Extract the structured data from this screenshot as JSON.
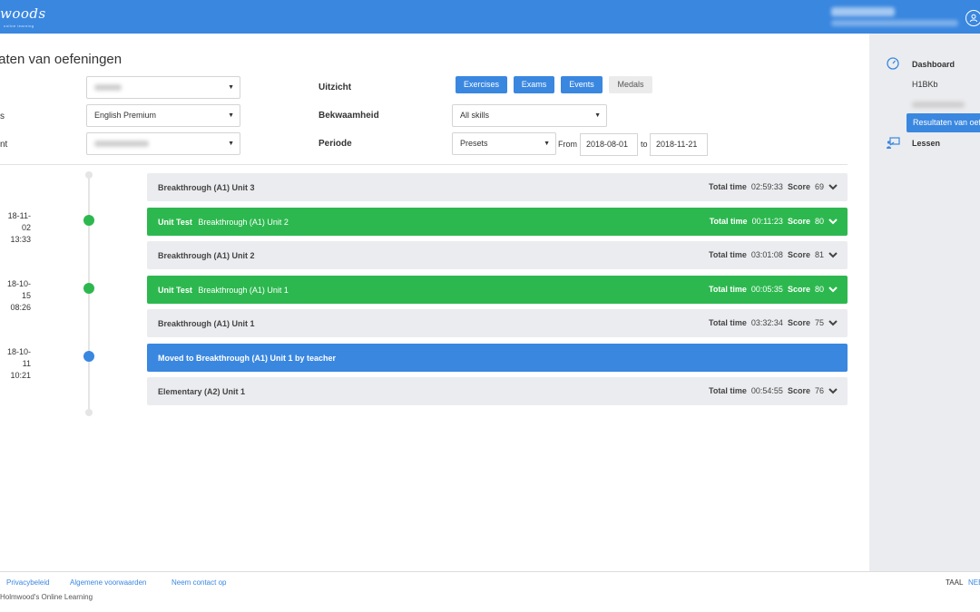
{
  "header": {
    "logo": "woods",
    "logo_sub": "online learning"
  },
  "page": {
    "title": "taten van oefeningen"
  },
  "filters": {
    "label_row2": "s",
    "label_row3": "nt",
    "course_value": "English Premium",
    "uitzicht_label": "Uitzicht",
    "bekwaamheid_label": "Bekwaamheid",
    "periode_label": "Periode",
    "view_buttons": [
      "Exercises",
      "Exams",
      "Events",
      "Medals"
    ],
    "skill_value": "All skills",
    "period_value": "Presets",
    "from_label": "From",
    "from_date": "2018-08-01",
    "to_label": "to",
    "to_date": "2018-11-21"
  },
  "timeline": {
    "dates": [
      {
        "date": "18-11-02",
        "time": "13:33"
      },
      {
        "date": "18-10-15",
        "time": "08:26"
      },
      {
        "date": "18-10-11",
        "time": "10:21"
      }
    ],
    "rows": [
      {
        "prefix": "",
        "title": "Breakthrough (A1) Unit 3",
        "time_label": "Total time",
        "time": "02:59:33",
        "score_label": "Score",
        "score": "69"
      },
      {
        "prefix": "Unit Test",
        "title": "Breakthrough (A1) Unit 2",
        "time_label": "Total time",
        "time": "00:11:23",
        "score_label": "Score",
        "score": "80"
      },
      {
        "prefix": "",
        "title": "Breakthrough (A1) Unit 2",
        "time_label": "Total time",
        "time": "03:01:08",
        "score_label": "Score",
        "score": "81"
      },
      {
        "prefix": "Unit Test",
        "title": "Breakthrough (A1) Unit 1",
        "time_label": "Total time",
        "time": "00:05:35",
        "score_label": "Score",
        "score": "80"
      },
      {
        "prefix": "",
        "title": "Breakthrough (A1) Unit 1",
        "time_label": "Total time",
        "time": "03:32:34",
        "score_label": "Score",
        "score": "75"
      },
      {
        "prefix": "",
        "title": "Moved to Breakthrough (A1) Unit 1 by teacher"
      },
      {
        "prefix": "",
        "title": "Elementary (A2) Unit 1",
        "time_label": "Total time",
        "time": "00:54:55",
        "score_label": "Score",
        "score": "76"
      }
    ]
  },
  "sidebar": {
    "dashboard": "Dashboard",
    "class_code": "H1BKb",
    "active": "Resultaten van oef",
    "lessen": "Lessen"
  },
  "footer": {
    "links": [
      "Privacybeleid",
      "Algemene voorwaarden",
      "Neem contact op"
    ],
    "copyright": "Holmwood's Online Learning",
    "taal": "TAAL",
    "lang": "NEE"
  },
  "colors": {
    "primary": "#3a87e0",
    "success": "#2db84f",
    "row_gray": "#ebecef"
  }
}
